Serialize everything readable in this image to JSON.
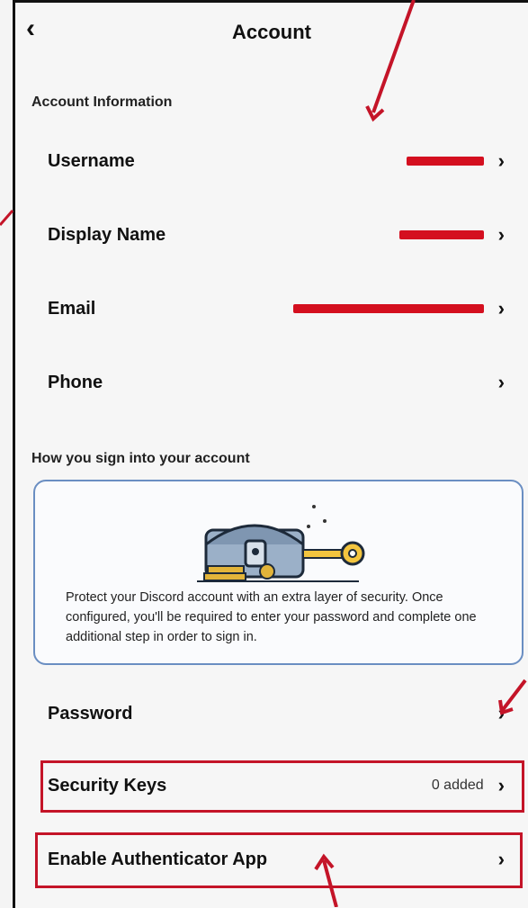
{
  "header": {
    "back_icon": "back-chevron-icon",
    "title": "Account"
  },
  "sections": {
    "account_info": "Account Information",
    "sign_in": "How you sign into your account"
  },
  "account_rows": [
    {
      "label": "Username",
      "value": ""
    },
    {
      "label": "Display Name",
      "value": ""
    },
    {
      "label": "Email",
      "value": ""
    },
    {
      "label": "Phone",
      "value": ""
    }
  ],
  "security_card": {
    "description": "Protect your Discord account with an extra layer of security. Once configured, you'll be required to enter your password and complete one additional step in order to sign in.",
    "illustration": "treasure-chest-key-illustration"
  },
  "sign_in_rows": [
    {
      "label": "Password",
      "value": ""
    },
    {
      "label": "Security Keys",
      "value": "0 added"
    },
    {
      "label": "Enable Authenticator App",
      "value": ""
    }
  ],
  "colors": {
    "annotation_red": "#c41428",
    "redaction_red": "#d40f1f",
    "card_border": "#6a8ec2"
  }
}
